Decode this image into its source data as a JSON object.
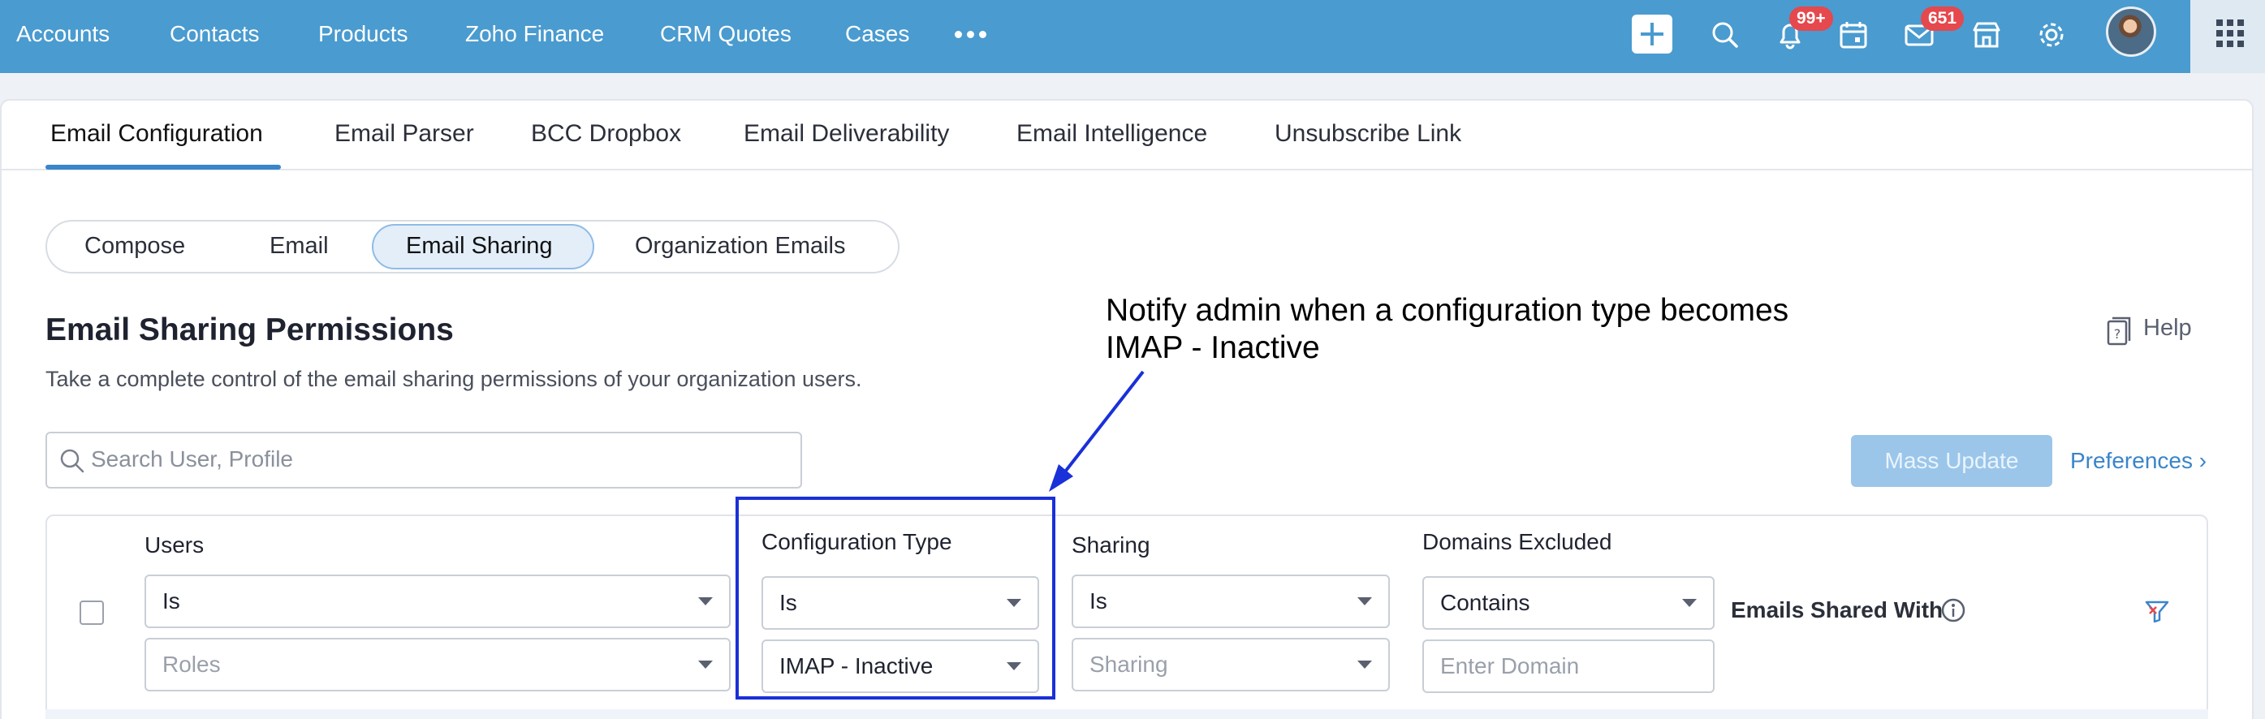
{
  "topnav": {
    "items": [
      "Accounts",
      "Contacts",
      "Products",
      "Zoho Finance",
      "CRM Quotes",
      "Cases"
    ],
    "notifications_badge": "99+",
    "mail_badge": "651"
  },
  "subtabs": [
    "Email Configuration",
    "Email Parser",
    "BCC Dropbox",
    "Email Deliverability",
    "Email Intelligence",
    "Unsubscribe Link"
  ],
  "segments": [
    "Compose",
    "Email",
    "Email Sharing",
    "Organization Emails"
  ],
  "page": {
    "title": "Email Sharing Permissions",
    "description": "Take a complete control of the email sharing permissions of your organization users.",
    "help": "Help"
  },
  "annotation": {
    "line1": "Notify admin when a configuration type  becomes",
    "line2": "IMAP - Inactive",
    "color": "#1a30d8"
  },
  "search": {
    "placeholder": "Search User, Profile"
  },
  "actions": {
    "mass_update": "Mass Update",
    "preferences": "Preferences"
  },
  "filters": {
    "users": {
      "label": "Users",
      "operator": "Is",
      "value_placeholder": "Roles"
    },
    "configuration_type": {
      "label": "Configuration Type",
      "operator": "Is",
      "value": "IMAP - Inactive"
    },
    "sharing": {
      "label": "Sharing",
      "operator": "Is",
      "value_placeholder": "Sharing"
    },
    "domains_excluded": {
      "label": "Domains Excluded",
      "operator": "Contains",
      "value_placeholder": "Enter Domain"
    },
    "emails_shared_with": {
      "label": "Emails Shared With"
    }
  },
  "colors": {
    "topbar": "#4a9bcf",
    "accent": "#3a85c9",
    "badge": "#e5484d"
  }
}
